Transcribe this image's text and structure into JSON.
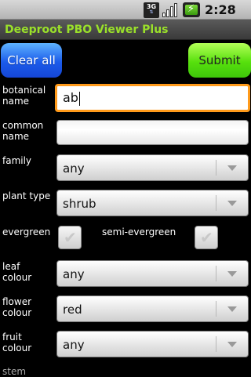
{
  "status_bar": {
    "network_label": "3G",
    "time": "2:28",
    "time_suffix": "PM"
  },
  "app": {
    "title": "Deeproot PBO Viewer Plus"
  },
  "buttons": {
    "clear_label": "Clear all",
    "submit_label": "Submit"
  },
  "form": {
    "botanical_name": {
      "label": "botanical\nname",
      "value": "ab"
    },
    "common_name": {
      "label": "common\nname",
      "value": ""
    },
    "family": {
      "label": "family",
      "value": "any"
    },
    "plant_type": {
      "label": "plant type",
      "value": "shrub"
    },
    "evergreen": {
      "label": "evergreen",
      "checked": false
    },
    "semi_evergreen": {
      "label": "semi-evergreen",
      "checked": false
    },
    "leaf_colour": {
      "label": "leaf\ncolour",
      "value": "any"
    },
    "flower_colour": {
      "label": "flower\ncolour",
      "value": "red"
    },
    "fruit_colour": {
      "label": "fruit\ncolour",
      "value": "any"
    },
    "stem": {
      "label": "stem"
    }
  },
  "colors": {
    "title_green": "#9ae02a",
    "clear_blue": "#1b5bea",
    "submit_green": "#57e00d",
    "focus_orange": "#ff9a1a"
  }
}
